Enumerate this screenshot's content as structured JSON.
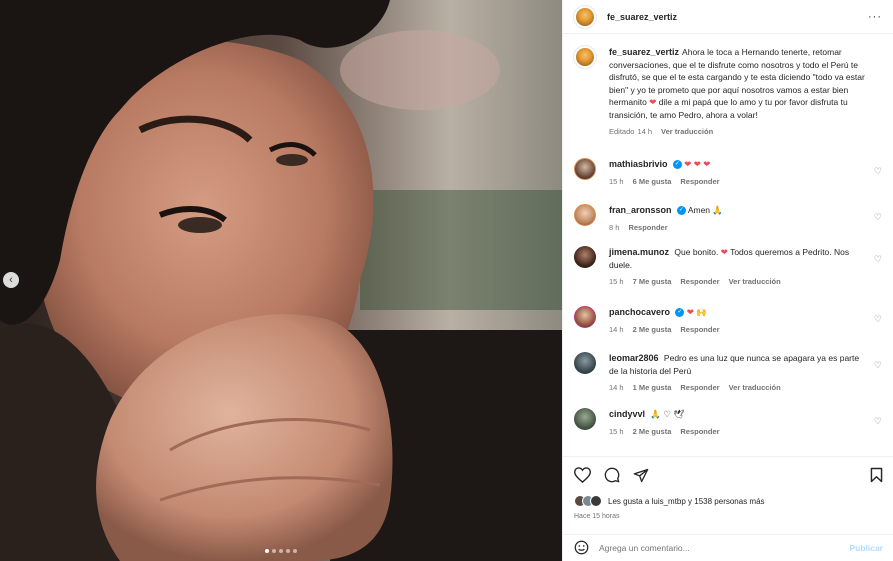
{
  "post": {
    "author": "fe_suarez_vertiz",
    "more_icon": "more-horizontal-icon",
    "carousel_pages": 5,
    "carousel_active": 0
  },
  "caption": {
    "username": "fe_suarez_vertiz",
    "text_before_heart": "Ahora le toca a Hernando tenerte, retomar conversaciones, que el te disfrute como nosotros y todo el Perú te disfrutó, se que el te esta cargando y te esta diciendo \"todo va estar bien\" y yo te prometo que por aquí nosotros vamos a estar bien hermanito",
    "text_after_heart": "dile a mi papá que lo amo y tu por favor disfruta tu transición, te amo Pedro, ahora a volar!",
    "edited": "Editado",
    "time": "14 h",
    "translate": "Ver traducción"
  },
  "comments": [
    {
      "username": "mathiasbrivio",
      "verified": true,
      "text": "",
      "emoji": "❤ ❤ ❤",
      "time": "15 h",
      "likes": "6 Me gusta",
      "reply": "Responder",
      "translate": ""
    },
    {
      "username": "fran_aronsson",
      "verified": true,
      "text": "Amen",
      "emoji": "🙏",
      "time": "8 h",
      "likes": "",
      "reply": "Responder",
      "translate": ""
    },
    {
      "username": "jimena.munoz",
      "verified": false,
      "text": "Que bonito.",
      "text2": "Todos queremos a Pedrito. Nos duele.",
      "emoji": "❤",
      "time": "15 h",
      "likes": "7 Me gusta",
      "reply": "Responder",
      "translate": "Ver traducción"
    },
    {
      "username": "panchocavero",
      "verified": true,
      "text": "",
      "emoji": "❤ 🙌",
      "time": "14 h",
      "likes": "2 Me gusta",
      "reply": "Responder",
      "translate": ""
    },
    {
      "username": "leomar2806",
      "verified": false,
      "text": "Pedro es una luz que nunca se apagara ya es parte de la historia del Perú",
      "emoji": "",
      "time": "14 h",
      "likes": "1 Me gusta",
      "reply": "Responder",
      "translate": "Ver traducción"
    },
    {
      "username": "cindyvvl",
      "verified": false,
      "text": "",
      "emoji": "🙏 ♡ 🕊",
      "time": "15 h",
      "likes": "2 Me gusta",
      "reply": "Responder",
      "translate": ""
    }
  ],
  "likes": {
    "text": "Les gusta a luis_mtbp y 1538 personas más",
    "time_ago": "Hace 15 horas"
  },
  "add_comment": {
    "placeholder": "Agrega un comentario...",
    "post_label": "Publicar",
    "emoji_icon": "emoji-smile-icon"
  },
  "colors": {
    "link_blue": "#0095f6",
    "post_disabled": "#b3dbff",
    "heart_red": "#ed4956",
    "meta_gray": "#737373"
  }
}
